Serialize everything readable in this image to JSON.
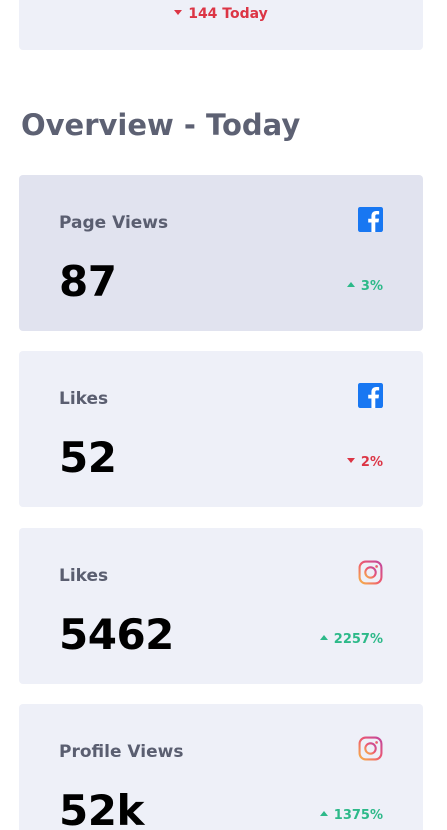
{
  "top_card": {
    "change": "144 Today",
    "direction": "down"
  },
  "section": {
    "title": "Overview - Today"
  },
  "stats": [
    {
      "label": "Page Views",
      "value": "87",
      "change": "3%",
      "direction": "up",
      "icon": "facebook-icon"
    },
    {
      "label": "Likes",
      "value": "52",
      "change": "2%",
      "direction": "down",
      "icon": "facebook-icon"
    },
    {
      "label": "Likes",
      "value": "5462",
      "change": "2257%",
      "direction": "up",
      "icon": "instagram-icon"
    },
    {
      "label": "Profile Views",
      "value": "52k",
      "change": "1375%",
      "direction": "up",
      "icon": "instagram-icon"
    }
  ],
  "colors": {
    "up": "#2db989",
    "down": "#dc3545",
    "facebook": "#1877f2",
    "card_bg": "#eef0f8",
    "card_active_bg": "#e1e3ef"
  }
}
